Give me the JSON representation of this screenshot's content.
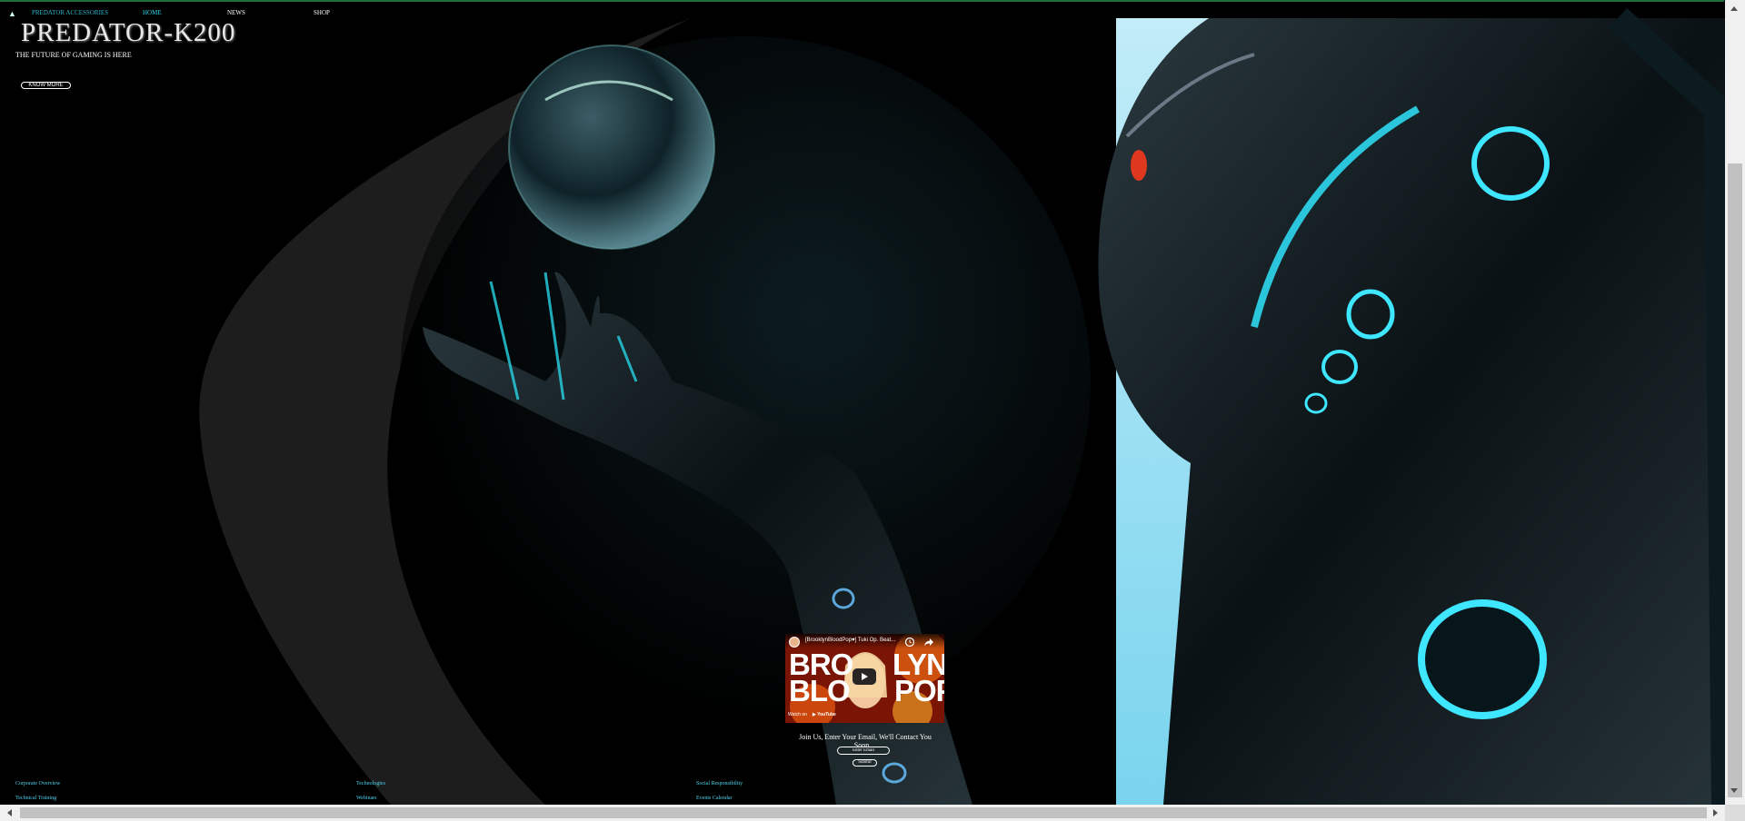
{
  "nav": {
    "brand": "PREDATOR ACCESSORIES",
    "home": "HOME",
    "news": "NEWS",
    "shop": "SHOP",
    "arrow_icon": "up-arrow-icon"
  },
  "hero": {
    "title": "PREDATOR-K200",
    "subtitle": "THE FUTURE OF GAMING IS HERE",
    "button_label": "KNOW MORE"
  },
  "video": {
    "title": "[BrooklynBloodPop♥] Tuki Op. Beat...",
    "watch_later": "Watch later",
    "share": "Share",
    "big_words": [
      "BRO",
      "LYN",
      "BLO",
      "POP"
    ],
    "watch_on": "Watch on",
    "youtube": "▶ YouTube"
  },
  "subscribe": {
    "text": "Join Us, Enter Your Email, We'll Contact You Soon....",
    "email_placeholder": "Enter Email",
    "submit_label": "Submit"
  },
  "footer": {
    "col1": [
      "Corporate Overview",
      "Technical Training"
    ],
    "col2": [
      "Technologies",
      "Webinars"
    ],
    "col3": [
      "Social Responsibility",
      "Events Calendar"
    ]
  },
  "colors": {
    "accent": "#2fd6e8",
    "panel_sky": "#8ad9ef",
    "topline": "#1d6f3a"
  }
}
